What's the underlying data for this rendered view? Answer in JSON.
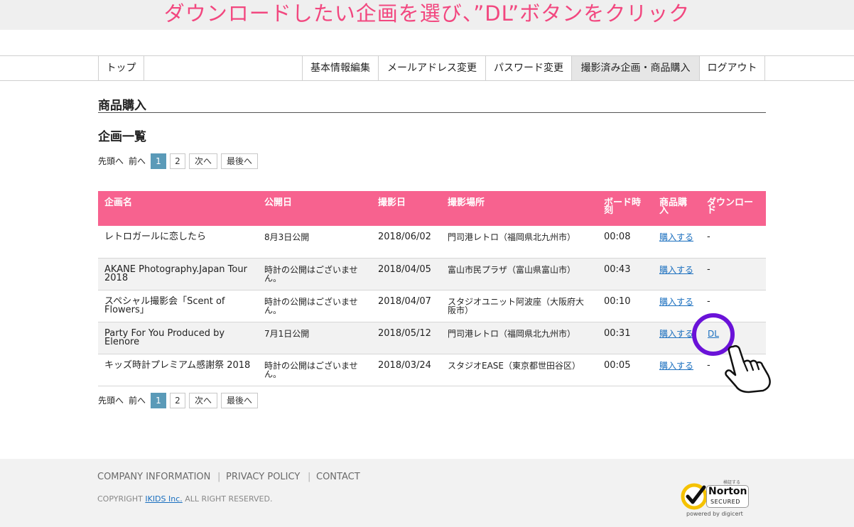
{
  "banner": {
    "text": "ダウンロードしたい企画を選び、”DL”ボタンをクリック"
  },
  "nav": {
    "items": [
      {
        "label": "トップ"
      },
      {
        "label": "基本情報編集"
      },
      {
        "label": "メールアドレス変更"
      },
      {
        "label": "パスワード変更"
      },
      {
        "label": "撮影済み企画・商品購入",
        "active": true
      },
      {
        "label": "ログアウト"
      }
    ]
  },
  "page": {
    "title": "商品購入",
    "subtitle": "企画一覧"
  },
  "pagination": {
    "first": "先頭へ",
    "prev": "前へ",
    "pages": [
      "1",
      "2"
    ],
    "current": "1",
    "next": "次へ",
    "last": "最後へ"
  },
  "table": {
    "headers": [
      "企画名",
      "公開日",
      "撮影日",
      "撮影場所",
      "ボード時刻",
      "商品購入",
      "ダウンロード"
    ],
    "rows": [
      {
        "name": "レトロガールに恋したら",
        "publish": "8月3日公開",
        "date": "2018/06/02",
        "place": "門司港レトロ（福岡県北九州市）",
        "time": "00:08",
        "buy": "購入する",
        "download": "-"
      },
      {
        "name": "AKANE Photography.Japan Tour 2018",
        "publish": "時計の公開はございません。",
        "date": "2018/04/05",
        "place": "富山市民プラザ（富山県富山市）",
        "time": "00:43",
        "buy": "購入する",
        "download": "-"
      },
      {
        "name": "スペシャル撮影会「Scent of Flowers」",
        "publish": "時計の公開はございません。",
        "date": "2018/04/07",
        "place": "スタジオユニット阿波座（大阪府大阪市）",
        "time": "00:10",
        "buy": "購入する",
        "download": "-"
      },
      {
        "name": "Party For You Produced by Elenore",
        "publish": "7月1日公開",
        "date": "2018/05/12",
        "place": "門司港レトロ（福岡県北九州市）",
        "time": "00:31",
        "buy": "購入する",
        "download": "DL"
      },
      {
        "name": "キッズ時計プレミアム感謝祭 2018",
        "publish": "時計の公開はございません。",
        "date": "2018/03/24",
        "place": "スタジオEASE（東京都世田谷区）",
        "time": "00:05",
        "buy": "購入する",
        "download": "-"
      }
    ]
  },
  "footer": {
    "links": [
      "COMPANY INFORMATION",
      "PRIVACY POLICY",
      "CONTACT"
    ],
    "copyright_prefix": "COPYRIGHT",
    "company": "IKIDS Inc.",
    "copyright_suffix": "ALL RIGHT RESERVED.",
    "badge": {
      "top": "検証する",
      "brand": "Norton",
      "sub": "SECURED",
      "powered": "powered by digicert"
    }
  },
  "colors": {
    "accent_pink": "#f7628f",
    "banner_text": "#f2477f",
    "highlight_circle": "#6a12d8",
    "page_current": "#5a9ab8"
  },
  "icons": {
    "highlight": "circle-highlight",
    "pointer": "pointing-hand-icon",
    "badge": "norton-check-icon"
  }
}
